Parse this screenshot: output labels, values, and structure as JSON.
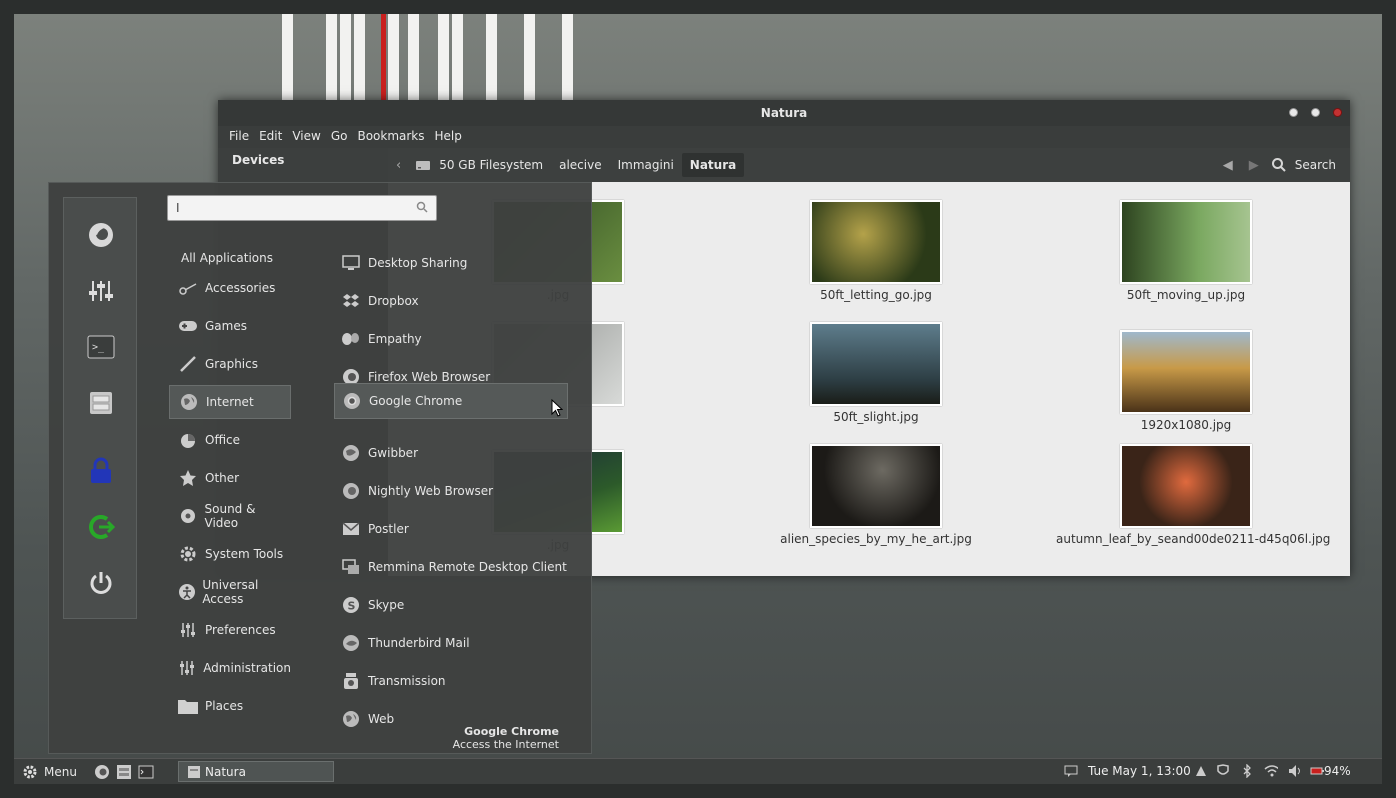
{
  "file_manager": {
    "title": "Natura",
    "menubar": [
      "File",
      "Edit",
      "View",
      "Go",
      "Bookmarks",
      "Help"
    ],
    "sidebar_heading": "Devices",
    "breadcrumbs": [
      "50 GB Filesystem",
      "alecive",
      "Immagini",
      "Natura"
    ],
    "search_label": "Search",
    "files": [
      {
        "name": ".jpg",
        "color": "#3a5a2a"
      },
      {
        "name": "50ft_letting_go.jpg",
        "color": "#3b4b20"
      },
      {
        "name": "50ft_moving_up.jpg",
        "color": "#5f8a48"
      },
      {
        "name": "",
        "color": "#b9bbb8"
      },
      {
        "name": "50ft_slight.jpg",
        "color": "#3e5567"
      },
      {
        "name": "1920x1080.jpg",
        "color": "#b58a3a"
      },
      {
        "name": ".jpg",
        "color": "#2d4a26"
      },
      {
        "name": "alien_species_by_my_he_art.jpg",
        "color": "#24221f"
      },
      {
        "name": "autumn_leaf_by_seand00de0211-d45q06l.jpg",
        "color": "#3a2418"
      }
    ]
  },
  "menu": {
    "search_placeholder": "I",
    "categories": [
      "All Applications",
      "Accessories",
      "Games",
      "Graphics",
      "Internet",
      "Office",
      "Other",
      "Sound & Video",
      "System Tools",
      "Universal Access",
      "Preferences",
      "Administration",
      "Places"
    ],
    "apps": [
      "Desktop Sharing",
      "Dropbox",
      "Empathy",
      "Firefox Web Browser",
      "Google Chrome",
      "Gwibber",
      "Nightly Web Browser",
      "Postler",
      "Remmina Remote Desktop Client",
      "Skype",
      "Thunderbird Mail",
      "Transmission",
      "Web"
    ],
    "description_title": "Google Chrome",
    "description_text": "Access the Internet"
  },
  "panel": {
    "menu_label": "Menu",
    "task": "Natura",
    "clock": "Tue May  1, 13:00",
    "battery": "94%"
  },
  "colors": {
    "accent_red": "#c8201e",
    "lock_blue": "#2236b8",
    "logout_green": "#28a828"
  }
}
